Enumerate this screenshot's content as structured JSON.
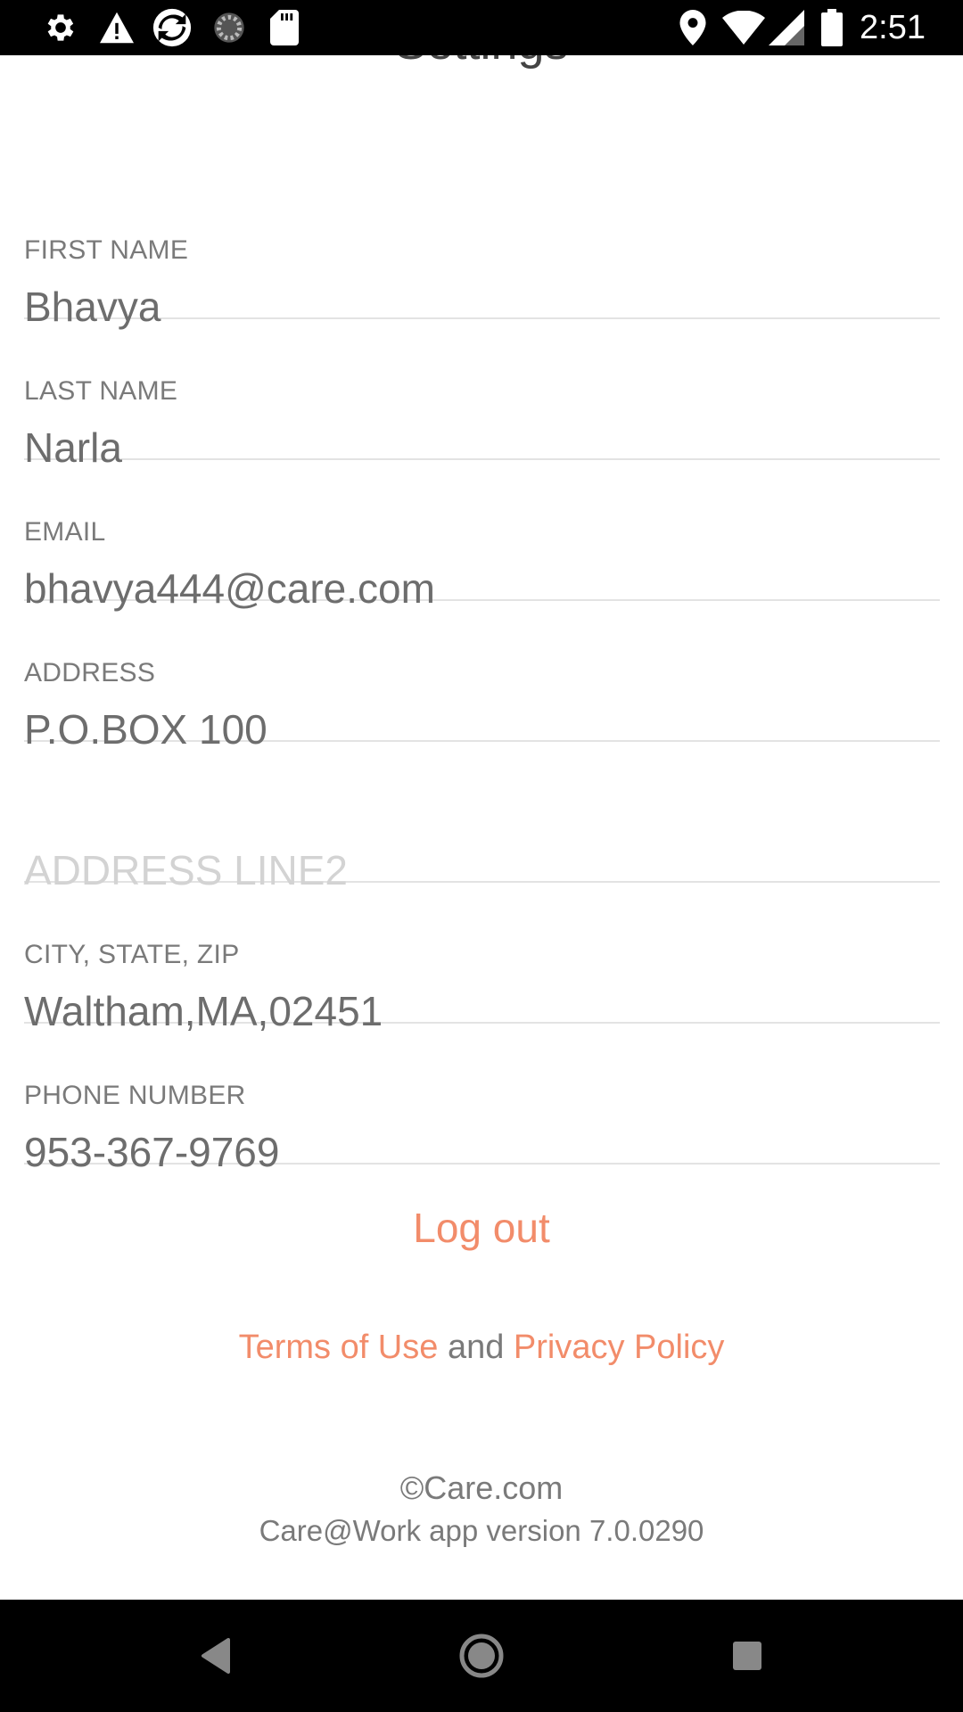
{
  "status_bar": {
    "time": "2:51",
    "left_icons": [
      "gear-icon",
      "warning-icon",
      "sync-icon",
      "loading-icon",
      "sd-card-icon"
    ],
    "right_icons": [
      "location-icon",
      "wifi-icon",
      "signal-icon",
      "battery-icon"
    ]
  },
  "screen": {
    "title": "Settings"
  },
  "form": {
    "fields": [
      {
        "label": "FIRST NAME",
        "value": "Bhavya"
      },
      {
        "label": "LAST NAME",
        "value": "Narla"
      },
      {
        "label": "EMAIL",
        "value": "bhavya444@care.com"
      },
      {
        "label": "ADDRESS",
        "value": "P.O.BOX 100"
      },
      {
        "label": "",
        "placeholder": "ADDRESS LINE2"
      },
      {
        "label": "CITY, STATE, ZIP",
        "value": "Waltham,MA,02451"
      },
      {
        "label": "PHONE NUMBER",
        "value": "953-367-9769"
      }
    ]
  },
  "actions": {
    "logout_label": "Log out"
  },
  "legal": {
    "terms_label": "Terms of Use",
    "and_text": "and",
    "privacy_label": "Privacy Policy"
  },
  "footer": {
    "copyright": "©Care.com",
    "version": "Care@Work app version 7.0.0290"
  },
  "nav_bar": {
    "buttons": [
      "back-icon",
      "home-icon",
      "recents-icon"
    ]
  },
  "colors": {
    "accent": "#f28c6a",
    "label": "#7a7a7a",
    "value": "#6d6d6d",
    "placeholder": "#d3d3d3",
    "divider": "#e3e3e3"
  }
}
